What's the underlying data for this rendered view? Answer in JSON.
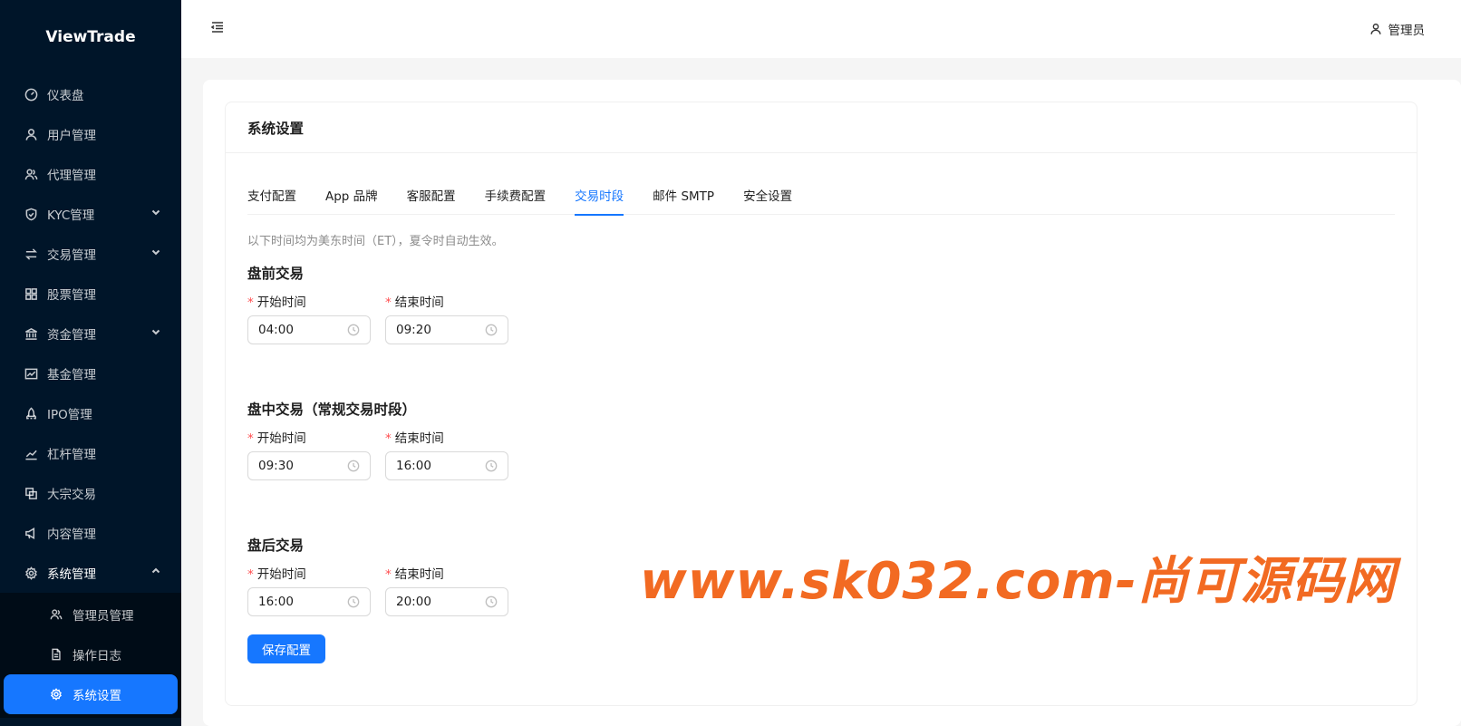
{
  "sidebar": {
    "brand": "ViewTrade",
    "items": [
      {
        "label": "仪表盘",
        "icon": "dashboard-icon"
      },
      {
        "label": "用户管理",
        "icon": "user-icon"
      },
      {
        "label": "代理管理",
        "icon": "team-icon"
      },
      {
        "label": "KYC管理",
        "icon": "shield-icon"
      },
      {
        "label": "交易管理",
        "icon": "swap-icon"
      },
      {
        "label": "股票管理",
        "icon": "appstore-icon"
      },
      {
        "label": "资金管理",
        "icon": "bank-icon"
      },
      {
        "label": "基金管理",
        "icon": "fund-icon"
      },
      {
        "label": "IPO管理",
        "icon": "rocket-icon"
      },
      {
        "label": "杠杆管理",
        "icon": "stock-icon"
      },
      {
        "label": "大宗交易",
        "icon": "block-icon"
      },
      {
        "label": "内容管理",
        "icon": "notification-icon"
      },
      {
        "label": "系统管理",
        "icon": "setting-icon"
      }
    ],
    "sub_items": [
      {
        "label": "管理员管理",
        "icon": "team-icon"
      },
      {
        "label": "操作日志",
        "icon": "file-icon"
      },
      {
        "label": "系统设置",
        "icon": "setting-icon"
      }
    ]
  },
  "header": {
    "user_label": "管理员"
  },
  "page": {
    "title": "系统设置",
    "tabs": [
      "支付配置",
      "App 品牌",
      "客服配置",
      "手续费配置",
      "交易时段",
      "邮件 SMTP",
      "安全设置"
    ],
    "active_tab": "交易时段",
    "notice": "以下时间均为美东时间（ET），夏令时自动生效。",
    "start_label": "开始时间",
    "end_label": "结束时间",
    "required_mark": "*",
    "sections": [
      {
        "title": "盘前交易",
        "start": "04:00",
        "end": "09:20"
      },
      {
        "title": "盘中交易（常规交易时段）",
        "start": "09:30",
        "end": "16:00"
      },
      {
        "title": "盘后交易",
        "start": "16:00",
        "end": "20:00"
      }
    ],
    "save_label": "保存配置"
  },
  "watermark": "www.sk032.com-尚可源码网",
  "colors": {
    "sidebar_bg": "#001529",
    "primary": "#1677ff",
    "required": "#ff4d4f",
    "watermark": "#f26a22"
  }
}
